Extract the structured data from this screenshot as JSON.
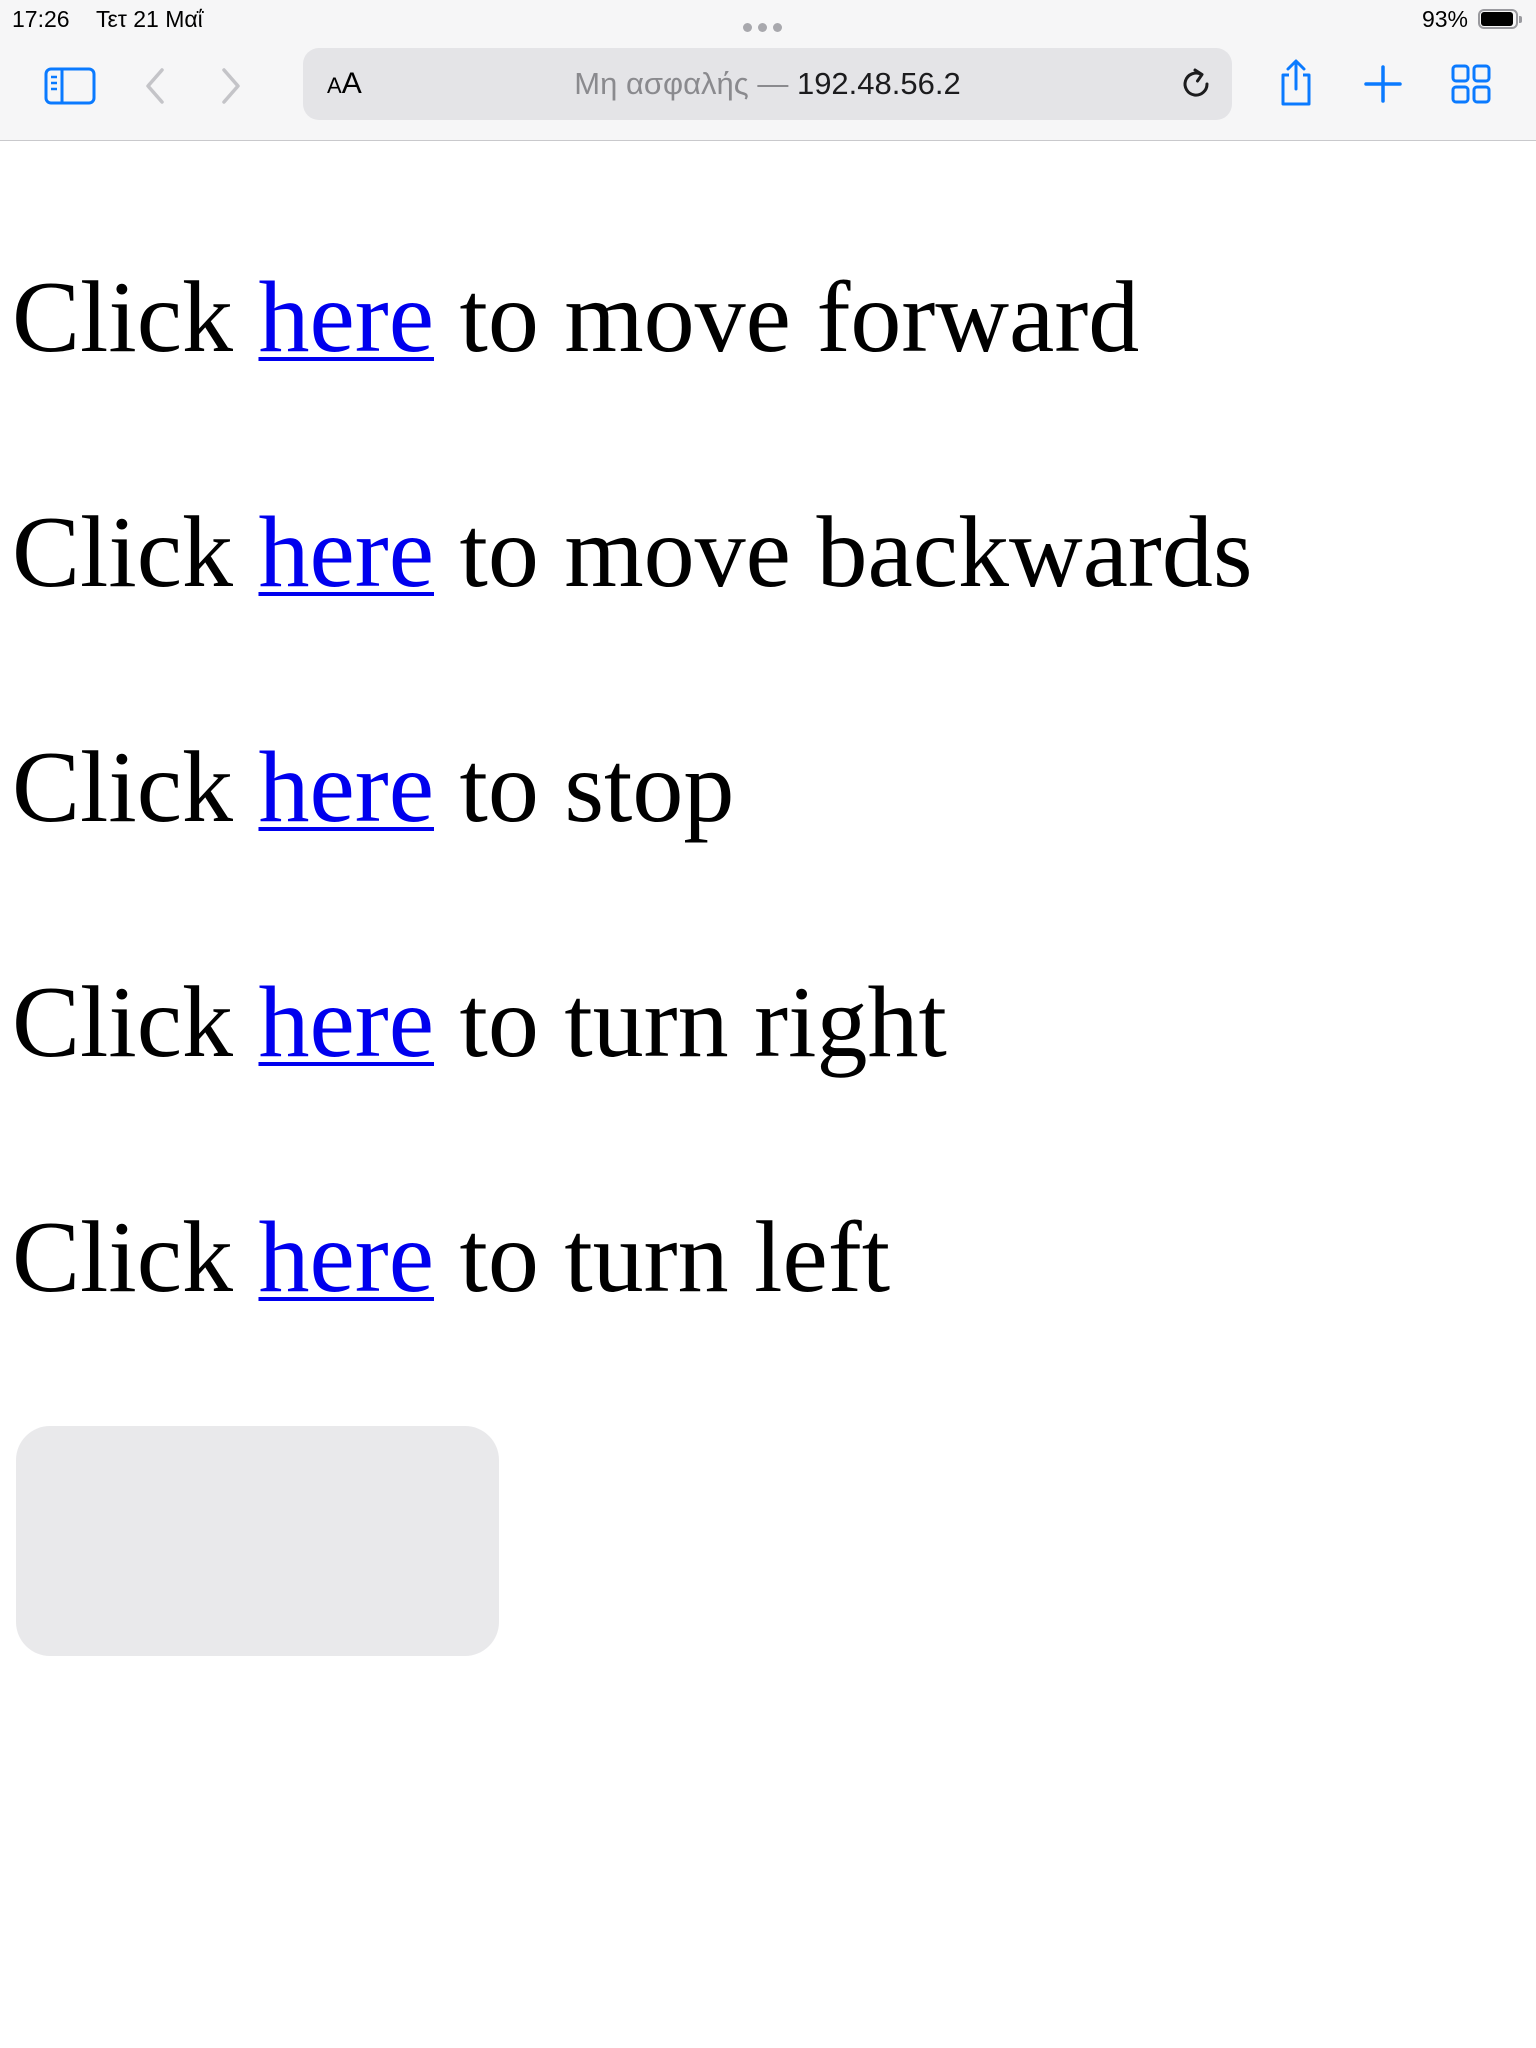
{
  "status_bar": {
    "time": "17:26",
    "date": "Τετ 21 Μαΐ",
    "battery_percent": "93%",
    "battery_level": 0.93
  },
  "toolbar": {
    "sidebar_icon": "sidebar-icon",
    "back_icon": "chevron-left-icon",
    "forward_icon": "chevron-right-icon",
    "reader_small": "A",
    "reader_big": "A",
    "address": {
      "security_label": "Μη ασφαλής",
      "separator": "—",
      "host": "192.48.56.2"
    },
    "reload_icon": "reload-icon",
    "share_icon": "share-icon",
    "add_icon": "plus-icon",
    "tabs_icon": "tabs-grid-icon",
    "accent_color": "#0a7aff"
  },
  "page": {
    "link_color": "#0000ee",
    "lines": [
      {
        "prefix": "Click ",
        "link": "here",
        "suffix": " to move forward"
      },
      {
        "prefix": "Click ",
        "link": "here",
        "suffix": " to move backwards"
      },
      {
        "prefix": "Click ",
        "link": "here",
        "suffix": " to stop"
      },
      {
        "prefix": "Click ",
        "link": "here",
        "suffix": " to turn right"
      },
      {
        "prefix": "Click ",
        "link": "here",
        "suffix": " to turn left"
      }
    ],
    "button_label": ""
  }
}
